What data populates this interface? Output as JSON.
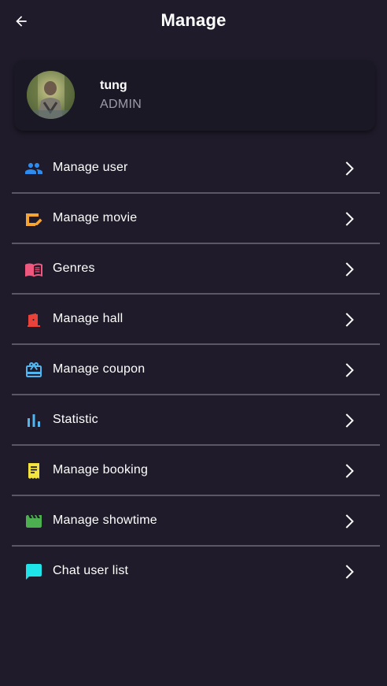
{
  "header": {
    "title": "Manage",
    "back_icon": "arrow-back-icon"
  },
  "profile": {
    "name": "tung",
    "role": "ADMIN"
  },
  "menu": [
    {
      "label": "Manage user",
      "icon": "people-icon",
      "color": "#2d8cf0"
    },
    {
      "label": "Manage movie",
      "icon": "movie-edit-icon",
      "color": "#f7a531"
    },
    {
      "label": "Genres",
      "icon": "book-icon",
      "color": "#f0577e"
    },
    {
      "label": "Manage hall",
      "icon": "door-icon",
      "color": "#e8423b"
    },
    {
      "label": "Manage coupon",
      "icon": "gift-card-icon",
      "color": "#4fb6ef"
    },
    {
      "label": "Statistic",
      "icon": "bar-chart-icon",
      "color": "#4fb6ef"
    },
    {
      "label": "Manage booking",
      "icon": "receipt-icon",
      "color": "#f4e33f"
    },
    {
      "label": "Manage showtime",
      "icon": "clapperboard-icon",
      "color": "#4caf50"
    },
    {
      "label": "Chat user list",
      "icon": "chat-icon",
      "color": "#1ee3e8"
    }
  ]
}
